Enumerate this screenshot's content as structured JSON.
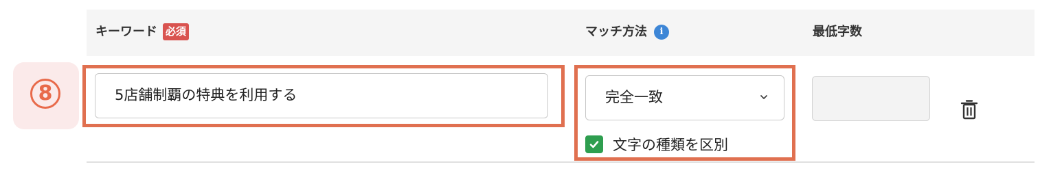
{
  "header": {
    "keyword_label": "キーワード",
    "required_badge": "必須",
    "match_label": "マッチ方法",
    "info_glyph": "i",
    "min_chars_label": "最低字数"
  },
  "row": {
    "step_number": "8",
    "keyword_value": "5店舗制覇の特典を利用する",
    "match_selected": "完全一致",
    "case_sensitive_label": "文字の種類を区別",
    "case_sensitive_checked": true,
    "min_chars_value": ""
  },
  "colors": {
    "highlight": "#e07050",
    "required_badge": "#d9534f",
    "info_icon": "#3d86d6",
    "checkbox": "#2e9e4f",
    "step_badge_bg": "#fbeaea"
  },
  "icons": {
    "info": "info-icon",
    "chevron": "chevron-down-icon",
    "checkbox": "checkmark-icon",
    "delete": "trash-icon"
  }
}
